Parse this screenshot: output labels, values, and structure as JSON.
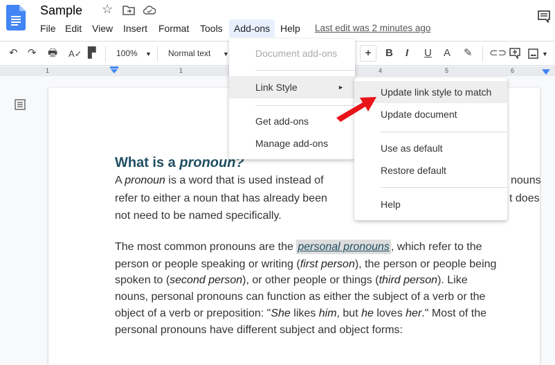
{
  "doc": {
    "title": "Sample",
    "last_edit": "Last edit was 2 minutes ago"
  },
  "menubar": [
    "File",
    "Edit",
    "View",
    "Insert",
    "Format",
    "Tools",
    "Add-ons",
    "Help"
  ],
  "toolbar": {
    "zoom": "100%",
    "style": "Normal text",
    "plus": "+",
    "bold": "B",
    "italic": "I",
    "underline": "U",
    "textcolor": "A"
  },
  "ruler": [
    "1",
    "1",
    "4",
    "5",
    "6"
  ],
  "addons_menu": {
    "items": [
      "Document add-ons",
      "Link Style",
      "Get add-ons",
      "Manage add-ons"
    ],
    "submenu_arrow": "►"
  },
  "link_style_submenu": {
    "items": [
      "Update link style to match",
      "Update document",
      "Use as default",
      "Restore default",
      "Help"
    ]
  },
  "content": {
    "heading_a": "What is a ",
    "heading_b": "pronoun",
    "heading_c": "?",
    "p1": [
      [
        "A ",
        "pronoun",
        " is a word that is used instead of"
      ],
      [
        "nouns"
      ],
      [
        "refer to either a noun that has already been"
      ],
      [
        "t does"
      ],
      [
        "not need to be named specifically."
      ]
    ],
    "p2": {
      "l1a": "The most common pronouns are the ",
      "l1link": "personal pronouns",
      "l1b": ", which refer to the",
      "l2a": "person or people speaking or writing (",
      "l2i": "first person",
      "l2b": "), the person or people being",
      "l3a": "spoken to (",
      "l3i": "second person",
      "l3b": "), or other people or things (",
      "l3i2": "third person",
      "l3c": "). Like",
      "l4": "nouns, personal pronouns can function as either the subject of a verb or the",
      "l5a": "object of a verb or preposition: \"",
      "l5i1": "She",
      " l5b": "",
      "l5b": " likes ",
      "l5i2": "him",
      "l5c": ", but ",
      "l5i3": "he",
      "l5d": " loves ",
      "l5i4": "her",
      "l5e": ".\" Most of the",
      "l6": "personal pronouns have different subject and object forms:"
    }
  },
  "colors": {
    "accent": "#4285f4",
    "heading": "#1f4e62",
    "link": "#1f4e62",
    "arrow": "#e8141a"
  }
}
